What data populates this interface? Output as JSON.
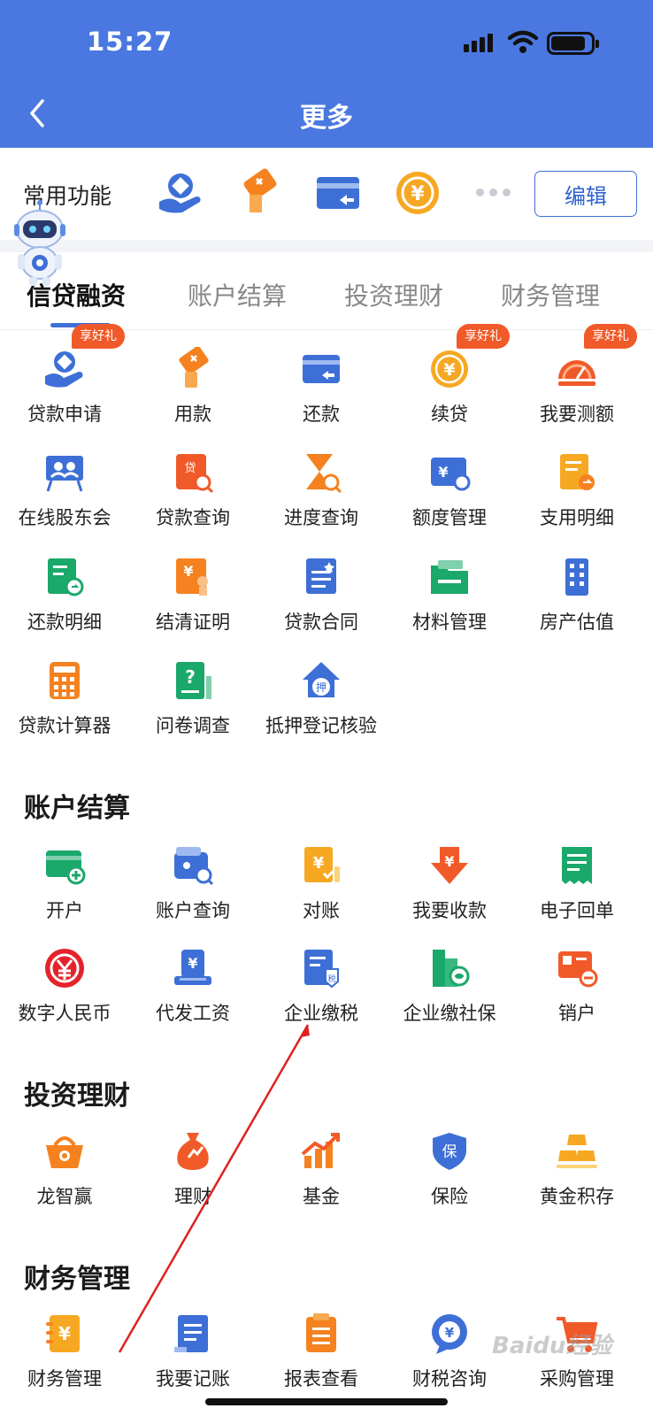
{
  "status_bar": {
    "time": "15:27"
  },
  "nav": {
    "title": "更多"
  },
  "common": {
    "label": "常用功能",
    "edit_label": "编辑",
    "icons": [
      "loan-apply-icon",
      "use-money-icon",
      "repay-card-icon",
      "renew-loan-icon"
    ]
  },
  "tabs": [
    "信贷融资",
    "账户结算",
    "投资理财",
    "财务管理"
  ],
  "credit": {
    "items": [
      {
        "label": "贷款申请",
        "icon": "hand-person-icon",
        "badge": "享好礼"
      },
      {
        "label": "用款",
        "icon": "money-hand-icon"
      },
      {
        "label": "还款",
        "icon": "card-return-icon"
      },
      {
        "label": "续贷",
        "icon": "yuan-coin-icon",
        "badge": "享好礼"
      },
      {
        "label": "我要测额",
        "icon": "gauge-icon",
        "badge": "享好礼"
      },
      {
        "label": "在线股东会",
        "icon": "meeting-board-icon"
      },
      {
        "label": "贷款查询",
        "icon": "loan-search-icon"
      },
      {
        "label": "进度查询",
        "icon": "hourglass-search-icon"
      },
      {
        "label": "额度管理",
        "icon": "quota-card-icon"
      },
      {
        "label": "支用明细",
        "icon": "detail-doc-icon"
      },
      {
        "label": "还款明细",
        "icon": "repay-doc-icon"
      },
      {
        "label": "结清证明",
        "icon": "settle-cert-icon"
      },
      {
        "label": "贷款合同",
        "icon": "contract-icon"
      },
      {
        "label": "材料管理",
        "icon": "folder-icon"
      },
      {
        "label": "房产估值",
        "icon": "building-icon"
      },
      {
        "label": "贷款计算器",
        "icon": "calculator-icon"
      },
      {
        "label": "问卷调查",
        "icon": "survey-icon"
      },
      {
        "label": "抵押登记核验",
        "icon": "mortgage-house-icon"
      }
    ]
  },
  "account": {
    "title": "账户结算",
    "items": [
      {
        "label": "开户",
        "icon": "open-account-icon"
      },
      {
        "label": "账户查询",
        "icon": "wallet-search-icon"
      },
      {
        "label": "对账",
        "icon": "reconcile-icon"
      },
      {
        "label": "我要收款",
        "icon": "receive-money-icon"
      },
      {
        "label": "电子回单",
        "icon": "receipt-icon"
      },
      {
        "label": "数字人民币",
        "icon": "digital-rmb-icon"
      },
      {
        "label": "代发工资",
        "icon": "salary-icon"
      },
      {
        "label": "企业缴税",
        "icon": "tax-doc-icon"
      },
      {
        "label": "企业缴社保",
        "icon": "social-security-icon"
      },
      {
        "label": "销户",
        "icon": "close-account-icon"
      }
    ]
  },
  "invest": {
    "title": "投资理财",
    "items": [
      {
        "label": "龙智赢",
        "icon": "basket-icon"
      },
      {
        "label": "理财",
        "icon": "money-bag-icon"
      },
      {
        "label": "基金",
        "icon": "fund-chart-icon"
      },
      {
        "label": "保险",
        "icon": "shield-insurance-icon"
      },
      {
        "label": "黄金积存",
        "icon": "gold-bars-icon"
      }
    ]
  },
  "finance": {
    "title": "财务管理",
    "items": [
      {
        "label": "财务管理",
        "icon": "finance-book-icon"
      },
      {
        "label": "我要记账",
        "icon": "bookkeeping-icon"
      },
      {
        "label": "报表查看",
        "icon": "report-icon"
      },
      {
        "label": "财税咨询",
        "icon": "tax-chat-icon"
      },
      {
        "label": "采购管理",
        "icon": "cart-icon"
      }
    ]
  },
  "colors": {
    "brand": "#4a78e0",
    "orange": "#f5821f",
    "blue": "#3d6fd6",
    "green": "#1aa86b",
    "red": "#f05a28"
  },
  "watermark": "Baidu经验"
}
